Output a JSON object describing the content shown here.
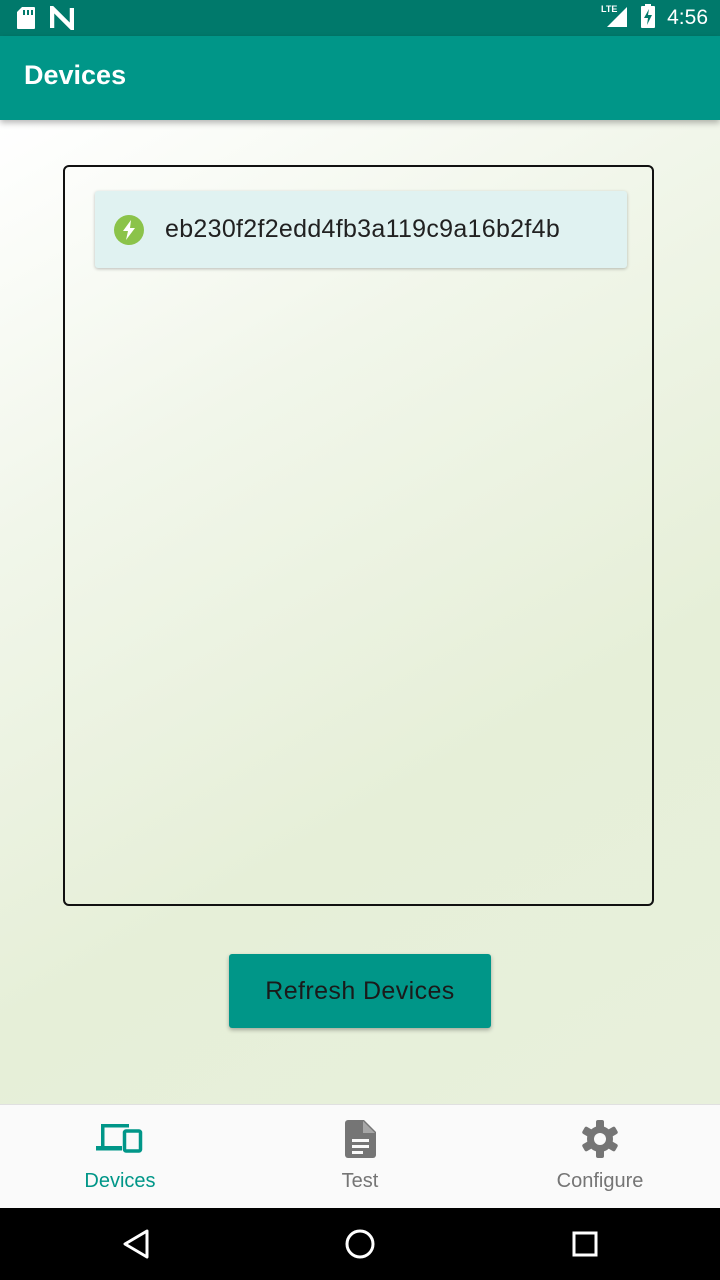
{
  "status_bar": {
    "time": "4:56",
    "network": "LTE",
    "left_icons": [
      "sd-card-icon",
      "n-logo-icon"
    ],
    "right_icons": [
      "signal-icon",
      "battery-charging-icon"
    ]
  },
  "app_bar": {
    "title": "Devices"
  },
  "device_list": {
    "items": [
      {
        "label": "eb230f2f2edd4fb3a119c9a16b2f4b",
        "icon": "lightning-bolt-icon",
        "icon_color": "#8bc34a"
      }
    ]
  },
  "refresh_button": {
    "label": "Refresh Devices"
  },
  "bottom_nav": {
    "items": [
      {
        "label": "Devices",
        "icon": "devices-icon",
        "active": true
      },
      {
        "label": "Test",
        "icon": "document-icon",
        "active": false
      },
      {
        "label": "Configure",
        "icon": "gear-icon",
        "active": false
      }
    ]
  },
  "system_nav": {
    "buttons": [
      "back-icon",
      "home-icon",
      "recents-icon"
    ]
  },
  "colors": {
    "status_bar": "#00796b",
    "primary": "#009688",
    "list_item_bg": "#e0f2f1",
    "active_nav": "#009688",
    "inactive_nav": "#757575"
  }
}
